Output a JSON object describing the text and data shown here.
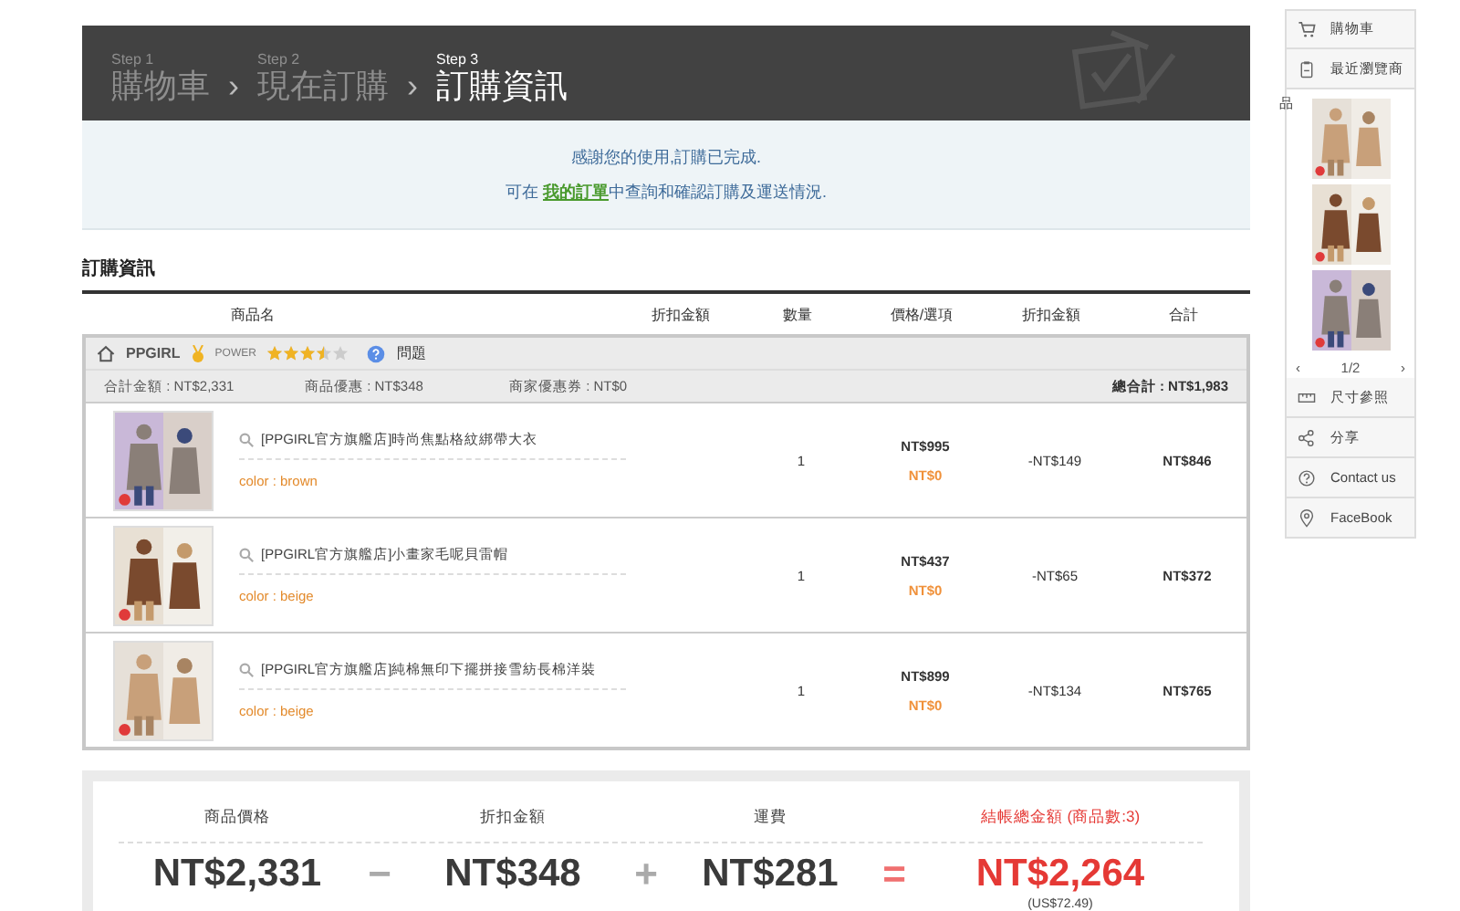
{
  "steps": [
    {
      "step": "Step 1",
      "label": "購物車",
      "selected": false
    },
    {
      "step": "Step 2",
      "label": "現在訂購",
      "selected": false
    },
    {
      "step": "Step 3",
      "label": "訂購資訊",
      "selected": true
    }
  ],
  "separator": "›",
  "notice": {
    "line1": "感謝您的使用,訂購已完成.",
    "line2_before": "可在",
    "link": "我的訂單",
    "line2_after": "中查詢和確認訂購及運送情況."
  },
  "section_title": "訂購資訊",
  "columns": [
    "商品名",
    "折扣金額",
    "數量",
    "價格/選項",
    "折扣金額",
    "合計"
  ],
  "store": {
    "name": "PPGIRL",
    "badge": "POWER",
    "stars": 3.5,
    "help": "問題",
    "subtotal": "合計金額 : NT$2,331",
    "product_discount": "商品優惠 : NT$348",
    "coupon": "商家優惠券 : NT$0",
    "total": "總合計 : NT$1,983"
  },
  "items": [
    {
      "kind": "picture",
      "name": "[PPGIRL官方旗艦店]時尚焦點格紋綁帶大衣",
      "option": "color : brown",
      "qty": "1",
      "price": "NT$995",
      "extra": "NT$0",
      "discount": "-NT$149",
      "total": "NT$846"
    },
    {
      "kind": "picture",
      "name": "[PPGIRL官方旗艦店]小畫家毛呢貝雷帽",
      "option": "color : beige",
      "qty": "1",
      "price": "NT$437",
      "extra": "NT$0",
      "discount": "-NT$65",
      "total": "NT$372"
    },
    {
      "kind": "picture",
      "name": "[PPGIRL官方旗艦店]純棉無印下擺拼接雪紡長棉洋裝",
      "option": "color : beige",
      "qty": "1",
      "price": "NT$899",
      "extra": "NT$0",
      "discount": "-NT$134",
      "total": "NT$765"
    }
  ],
  "summary": {
    "labels": [
      "商品價格",
      "折扣金額",
      "運費",
      "結帳總金額 (商品數:3)"
    ],
    "values": [
      "NT$2,331",
      "NT$348",
      "NT$281",
      "NT$2,264"
    ],
    "operators": [
      "−",
      "+",
      "="
    ],
    "usd": "(US$72.49)"
  },
  "sidebar": {
    "top": [
      {
        "kind": "cart",
        "label": "購物車"
      },
      {
        "kind": "clipboard",
        "label": "最近瀏覽商"
      }
    ],
    "overflow": "品",
    "prev": "‹",
    "page": "1/2",
    "next": "›",
    "bottom": [
      {
        "kind": "ruler",
        "label": "尺寸參照"
      },
      {
        "kind": "share",
        "label": "分享"
      },
      {
        "kind": "help",
        "label": "Contact us"
      },
      {
        "kind": "pin",
        "label": "FaceBook"
      }
    ]
  }
}
